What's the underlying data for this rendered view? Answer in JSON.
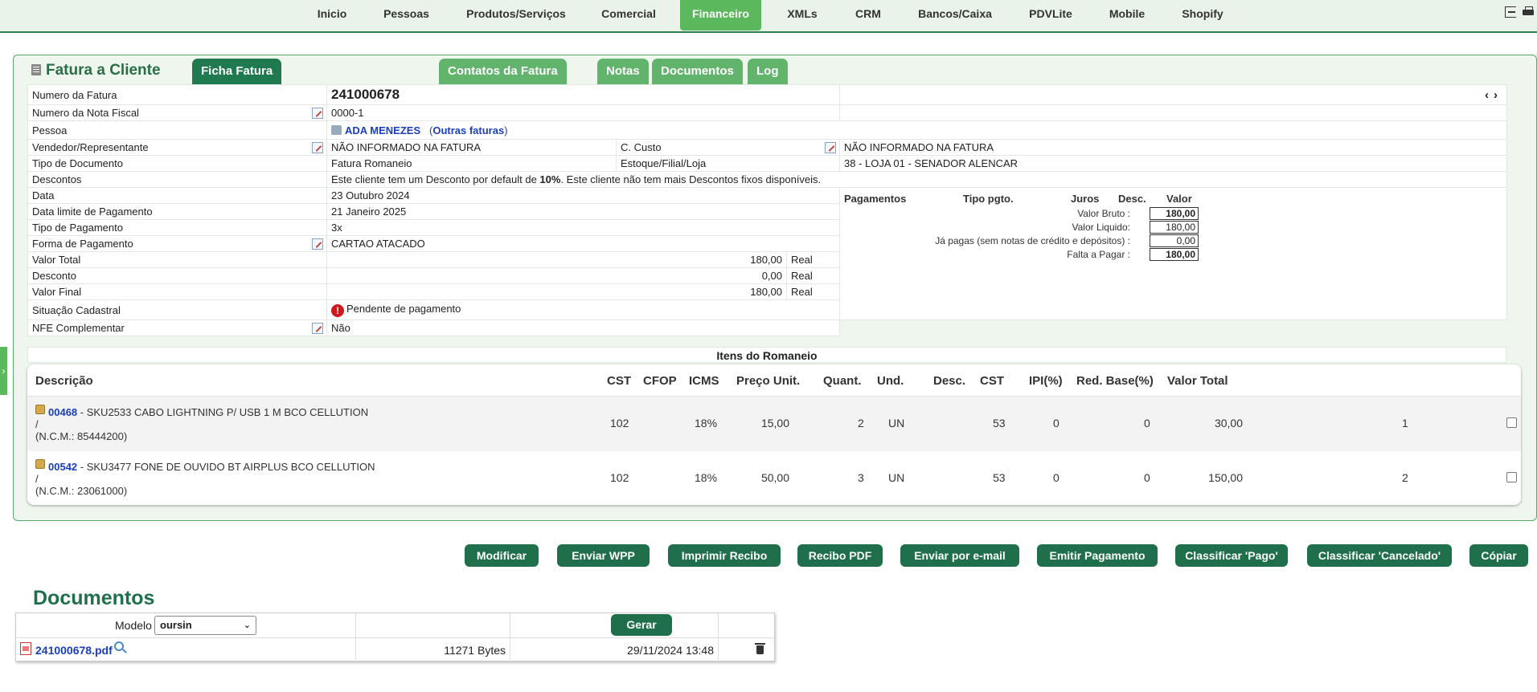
{
  "nav": {
    "items": [
      "Inicio",
      "Pessoas",
      "Produtos/Serviços",
      "Comercial",
      "Financeiro",
      "XMLs",
      "CRM",
      "Bancos/Caixa",
      "PDVLite",
      "Mobile",
      "Shopify"
    ],
    "active": "Financeiro",
    "icons": [
      "logout-icon",
      "print-icon"
    ]
  },
  "panel": {
    "title": "Fatura a Cliente",
    "tabs": [
      "Ficha Fatura",
      "Contatos da Fatura",
      "Notas",
      "Documentos",
      "Log"
    ],
    "active_tab": "Ficha Fatura"
  },
  "fields": {
    "numero_fatura_label": "Numero da Fatura",
    "numero_fatura_value": "241000678",
    "nav_prev": "‹",
    "nav_next": "›",
    "nota_fiscal_label": "Numero da Nota Fiscal",
    "nota_fiscal_value": "0000-1",
    "pessoa_label": "Pessoa",
    "pessoa_value": "ADA MENEZES",
    "outras_faturas_open": "(",
    "outras_faturas_label": "Outras faturas",
    "outras_faturas_close": ")",
    "vendedor_label": "Vendedor/Representante",
    "vendedor_value": "NÃO INFORMADO NA FATURA",
    "ccusto_label": "C. Custo",
    "ccusto_value": "NÃO INFORMADO NA FATURA",
    "tipo_doc_label": "Tipo de Documento",
    "tipo_doc_value": "Fatura Romaneio",
    "estoque_label": "Estoque/Filial/Loja",
    "estoque_value": "38 - LOJA 01 - SENADOR ALENCAR",
    "descontos_label": "Descontos",
    "descontos_pre": "Este cliente tem um Desconto por default de ",
    "descontos_pct": "10%",
    "descontos_post": ". Este cliente não tem mais Descontos fixos disponíveis.",
    "data_label": "Data",
    "data_value": "23 Outubro 2024",
    "data_limite_label": "Data limite de Pagamento",
    "data_limite_value": "21 Janeiro 2025",
    "tipo_pag_label": "Tipo de Pagamento",
    "tipo_pag_value": "3x",
    "forma_pag_label": "Forma de Pagamento",
    "forma_pag_value": "CARTAO ATACADO",
    "valor_total_label": "Valor Total",
    "valor_total_value": "180,00",
    "desconto_label": "Desconto",
    "desconto_value": "0,00",
    "valor_final_label": "Valor Final",
    "valor_final_value": "180,00",
    "currency": "Real",
    "situacao_label": "Situação Cadastral",
    "situacao_value": "Pendente de pagamento",
    "nfe_label": "NFE Complementar",
    "nfe_value": "Não"
  },
  "payments": {
    "headers": [
      "Pagamentos",
      "Tipo pgto.",
      "Juros",
      "Desc.",
      "Valor"
    ],
    "rows": [
      {
        "label": "Valor Bruto :",
        "value": "180,00",
        "bold": true
      },
      {
        "label": "Valor Liquido:",
        "value": "180,00",
        "bold": false
      },
      {
        "label": "Já pagas (sem notas de crédito e depósitos) :",
        "value": "0,00",
        "bold": false
      },
      {
        "label": "Falta a Pagar :",
        "value": "180,00",
        "bold": true
      }
    ]
  },
  "items_section": {
    "title": "Itens do Romaneio",
    "headers": [
      "Descrição",
      "CST",
      "CFOP",
      "ICMS",
      "Preço Unit.",
      "Quant.",
      "Und.",
      "Desc.",
      "CST",
      "IPI(%)",
      "Red. Base(%)",
      "Valor Total"
    ],
    "rows": [
      {
        "code": "00468",
        "desc": " - SKU2533 CABO LIGHTNING P/ USB 1 M BCO CELLUTION",
        "slash": "/",
        "ncm": "(N.C.M.: 85444200)",
        "cst": "102",
        "icms": "18%",
        "preco": "15,00",
        "quant": "2",
        "und": "UN",
        "cst2": "53",
        "ipi": "0",
        "red": "0",
        "total": "30,00",
        "idx": "1"
      },
      {
        "code": "00542",
        "desc": " - SKU3477 FONE DE OUVIDO BT AIRPLUS BCO CELLUTION",
        "slash": "/",
        "ncm": "(N.C.M.: 23061000)",
        "cst": "102",
        "icms": "18%",
        "preco": "50,00",
        "quant": "3",
        "und": "UN",
        "cst2": "53",
        "ipi": "0",
        "red": "0",
        "total": "150,00",
        "idx": "2"
      }
    ]
  },
  "actions": [
    "Modificar",
    "Enviar WPP",
    "Imprimir Recibo",
    "Recibo PDF",
    "Enviar por e-mail",
    "Emitir Pagamento",
    "Classificar 'Pago'",
    "Classificar 'Cancelado'",
    "Cópiar"
  ],
  "documents": {
    "title": "Documentos",
    "modelo_label": "Modelo",
    "modelo_value": "oursin",
    "gerar_label": "Gerar",
    "file_name": "241000678.pdf",
    "file_size": "11271 Bytes",
    "file_date": "29/11/2024 13:48"
  },
  "colors": {
    "accent": "#1e6f4a",
    "tab": "#62b46d",
    "nav_active": "#5cb85c",
    "link": "#1a3fb8",
    "alert": "#d0191e"
  }
}
